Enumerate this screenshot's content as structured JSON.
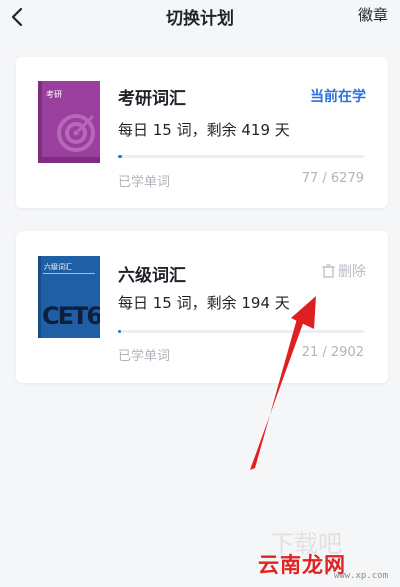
{
  "header": {
    "title": "切换计划",
    "right_link": "徽章"
  },
  "plans": [
    {
      "name": "考研词汇",
      "cover_label": "考研",
      "cover_color": "#9b3f9e",
      "schedule": "每日 15 词，剩余 419 天",
      "action": "当前在学",
      "learned_label": "已学单词",
      "learned_count": "77 / 6279",
      "progress": 0.0123
    },
    {
      "name": "六级词汇",
      "cover_label": "六级词汇",
      "cover_big_text": "CET6",
      "cover_color": "#1f5fa6",
      "schedule": "每日 15 词，剩余 194 天",
      "action": "删除",
      "learned_label": "已学单词",
      "learned_count": "21 / 2902",
      "progress": 0.0072
    }
  ],
  "watermark": {
    "text": "云南龙网",
    "url": "www.xp.com"
  },
  "colors": {
    "accent": "#2f6fe0",
    "annotation_arrow": "#e02020",
    "muted": "#b0b4bb"
  },
  "icons": {
    "back": "chevron-left-icon",
    "delete": "trash-icon"
  }
}
